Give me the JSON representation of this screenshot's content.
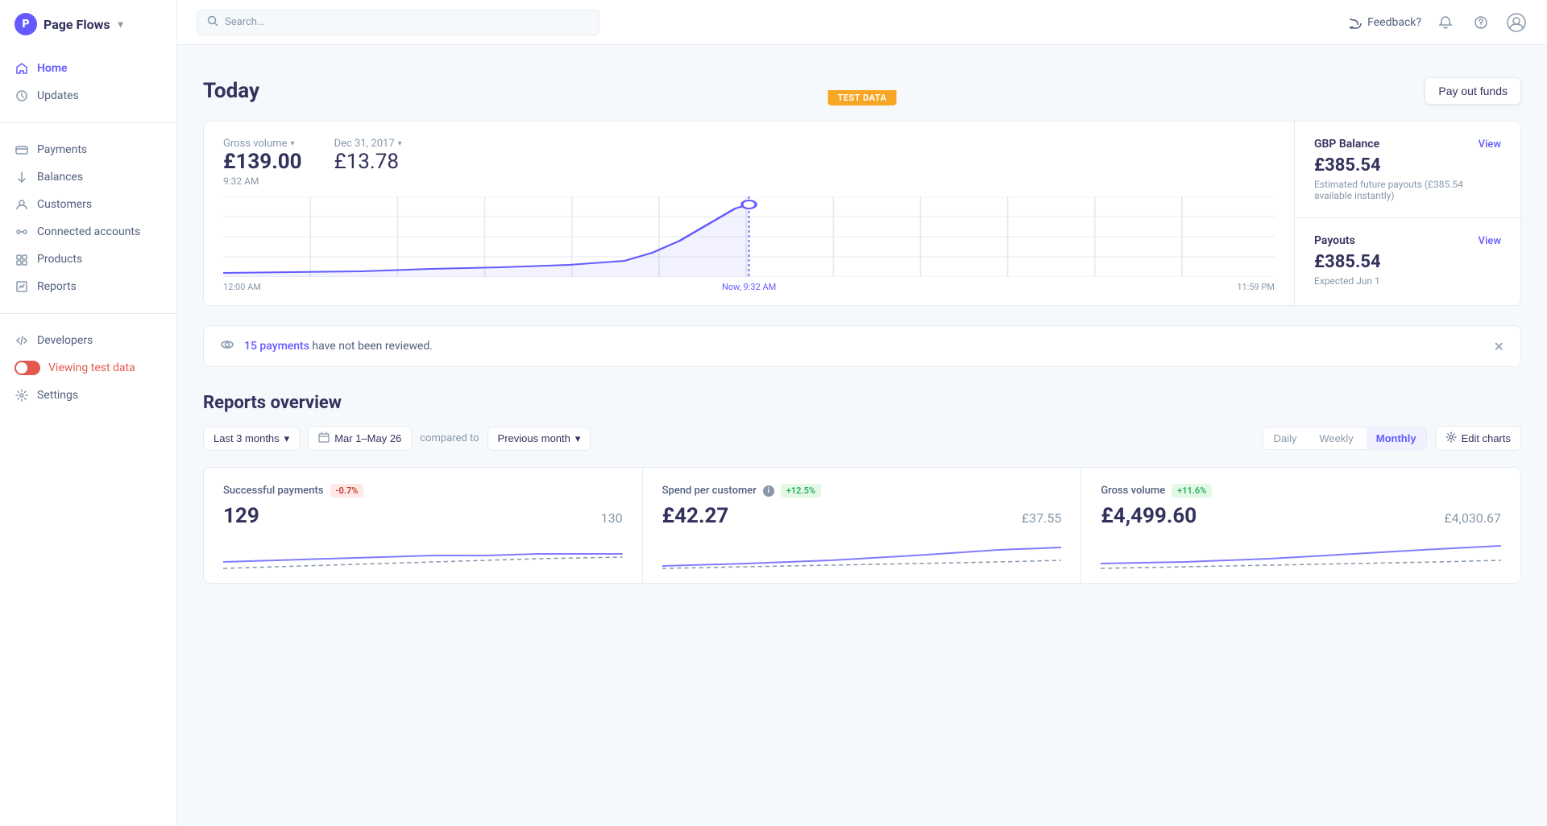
{
  "app": {
    "name": "Page Flows",
    "logo_letter": "P"
  },
  "sidebar": {
    "items": [
      {
        "id": "home",
        "label": "Home",
        "icon": "home",
        "active": true
      },
      {
        "id": "updates",
        "label": "Updates",
        "icon": "updates",
        "active": false
      }
    ],
    "payments_group": [
      {
        "id": "payments",
        "label": "Payments",
        "icon": "payments"
      },
      {
        "id": "balances",
        "label": "Balances",
        "icon": "balances"
      },
      {
        "id": "customers",
        "label": "Customers",
        "icon": "customers"
      },
      {
        "id": "connected-accounts",
        "label": "Connected accounts",
        "icon": "connected"
      },
      {
        "id": "products",
        "label": "Products",
        "icon": "products"
      },
      {
        "id": "reports",
        "label": "Reports",
        "icon": "reports"
      }
    ],
    "bottom_items": [
      {
        "id": "developers",
        "label": "Developers",
        "icon": "developers"
      },
      {
        "id": "settings",
        "label": "Settings",
        "icon": "settings"
      }
    ],
    "test_data_label": "Viewing test data"
  },
  "topbar": {
    "search_placeholder": "Search...",
    "feedback_label": "Feedback?",
    "test_data_banner": "TEST DATA"
  },
  "today_section": {
    "title": "Today",
    "pay_out_btn": "Pay out funds",
    "chart": {
      "gross_volume_label": "Gross volume",
      "date_label": "Dec 31, 2017",
      "main_value": "£139.00",
      "secondary_value": "£13.78",
      "time_label": "9:32 AM",
      "axis_start": "12:00 AM",
      "axis_mid": "Now, 9:32 AM",
      "axis_end": "11:59 PM"
    },
    "balance": {
      "title": "GBP Balance",
      "view_label": "View",
      "amount": "£385.54",
      "sub": "Estimated future payouts (£385.54 available instantly)"
    },
    "payouts": {
      "title": "Payouts",
      "view_label": "View",
      "amount": "£385.54",
      "expected": "Expected Jun 1"
    }
  },
  "notification": {
    "count": "15 payments",
    "text": " have not been reviewed."
  },
  "reports_overview": {
    "title": "Reports overview",
    "date_range_btn": "Last 3 months",
    "date_preset": "Mar 1–May 26",
    "compared_to_label": "compared to",
    "comparison_btn": "Previous month",
    "freq": {
      "daily": "Daily",
      "weekly": "Weekly",
      "monthly": "Monthly",
      "active": "Monthly"
    },
    "edit_charts_btn": "Edit charts",
    "cards": [
      {
        "title": "Successful payments",
        "badge": "-0.7%",
        "badge_type": "red",
        "main_value": "129",
        "compare_value": "130",
        "has_info": false
      },
      {
        "title": "Spend per customer",
        "badge": "+12.5%",
        "badge_type": "green",
        "main_value": "£42.27",
        "compare_value": "£37.55",
        "has_info": true
      },
      {
        "title": "Gross volume",
        "badge": "+11.6%",
        "badge_type": "green",
        "main_value": "£4,499.60",
        "compare_value": "£4,030.67",
        "has_info": false
      }
    ]
  }
}
